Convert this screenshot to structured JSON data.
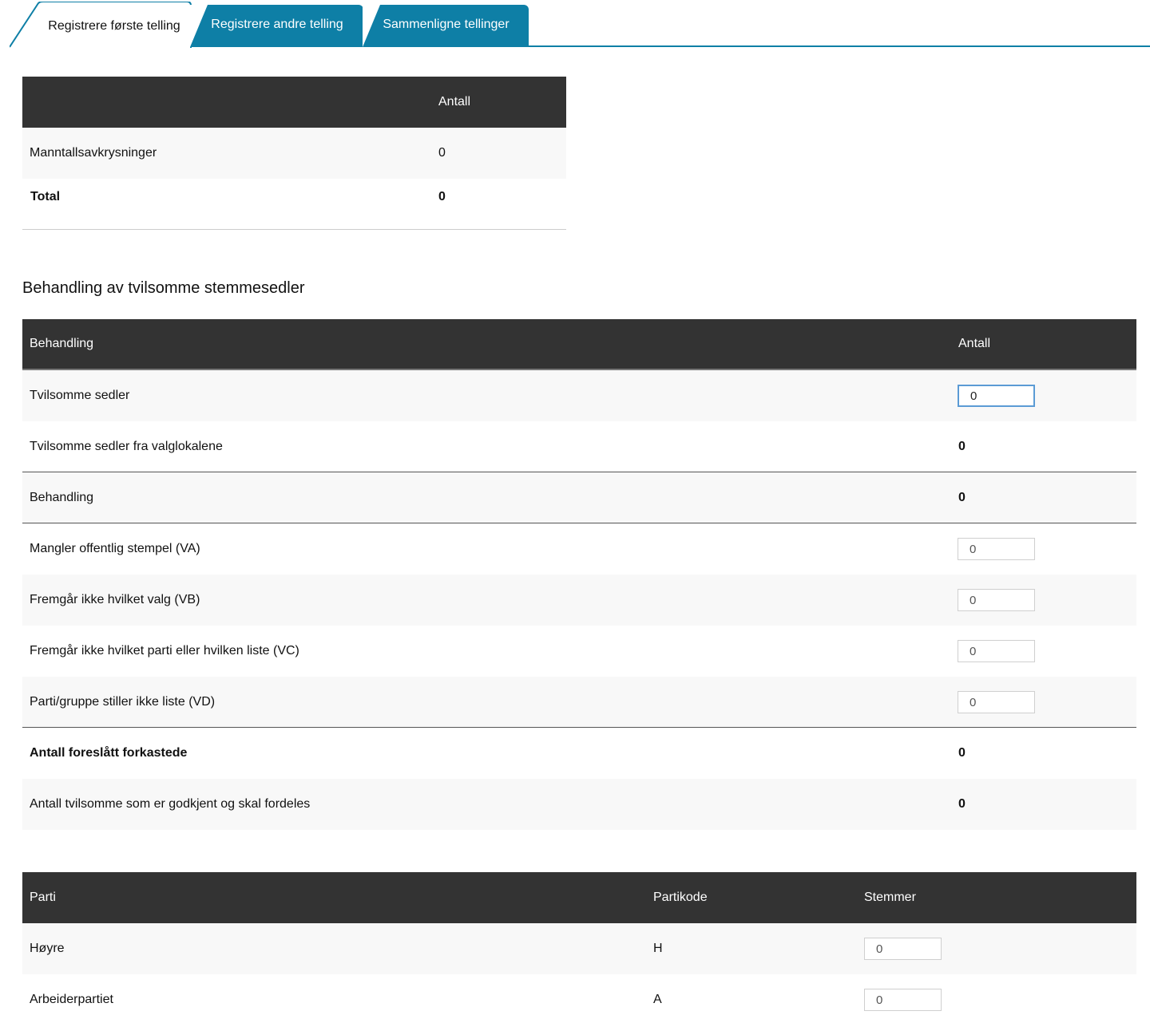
{
  "tabs": [
    {
      "label": "Registrere første telling",
      "active": true
    },
    {
      "label": "Registrere andre telling",
      "active": false
    },
    {
      "label": "Sammenligne tellinger",
      "active": false
    }
  ],
  "colors": {
    "accent": "#0e7fa6",
    "header_bg": "#333333",
    "row_alt": "#f8f8f8",
    "focus_border": "#5b9bd5"
  },
  "summary_table": {
    "header": {
      "label": "",
      "count": "Antall"
    },
    "rows": [
      {
        "label": "Manntallsavkrysninger",
        "value": "0"
      },
      {
        "label": "Total",
        "value": "0"
      }
    ]
  },
  "doubtful": {
    "title": "Behandling av tvilsomme stemmesedler",
    "header": {
      "label": "Behandling",
      "count": "Antall"
    },
    "rows": [
      {
        "label": "Tvilsomme sedler",
        "value": "0"
      },
      {
        "label": "Tvilsomme sedler fra valglokalene",
        "value": "0"
      },
      {
        "label": "Behandling",
        "value": "0"
      },
      {
        "label": "Mangler offentlig stempel (VA)",
        "value": "0"
      },
      {
        "label": "Fremgår ikke hvilket valg (VB)",
        "value": "0"
      },
      {
        "label": "Fremgår ikke hvilket parti eller hvilken liste (VC)",
        "value": "0"
      },
      {
        "label": "Parti/gruppe stiller ikke liste (VD)",
        "value": "0"
      },
      {
        "label": "Antall foreslått forkastede",
        "value": "0"
      },
      {
        "label": "Antall tvilsomme som er godkjent og skal fordeles",
        "value": "0"
      }
    ]
  },
  "parties": {
    "header": {
      "party": "Parti",
      "code": "Partikode",
      "votes": "Stemmer"
    },
    "rows": [
      {
        "party": "Høyre",
        "code": "H",
        "votes": "0"
      },
      {
        "party": "Arbeiderpartiet",
        "code": "A",
        "votes": "0"
      }
    ]
  }
}
